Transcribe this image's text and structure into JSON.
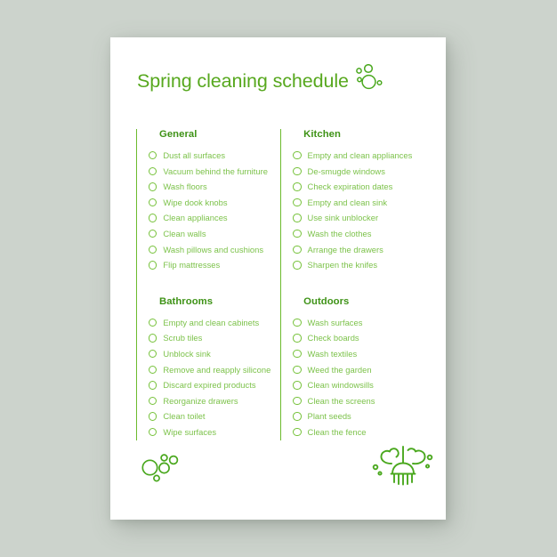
{
  "document": {
    "title": "Spring cleaning schedule",
    "background_color": "#ccd3cc",
    "paper_color": "#ffffff",
    "accent_green": "#57a81e",
    "heading_green": "#3f9317",
    "item_green": "#7cc24a",
    "rule_green": "#6cbb2e"
  },
  "decor": {
    "title_bubbles": "bubbles-icon",
    "footer_left": "bubbles-icon",
    "footer_right": "mop-with-bubbles-icon"
  },
  "columns": [
    {
      "id": "left",
      "sections": [
        {
          "heading": "General",
          "items": [
            "Dust all surfaces",
            "Vacuum behind the furniture",
            "Wash floors",
            "Wipe dook knobs",
            "Clean appliances",
            "Clean walls",
            "Wash pillows and cushions",
            "Flip mattresses"
          ]
        },
        {
          "heading": "Bathrooms",
          "items": [
            "Empty and clean cabinets",
            "Scrub tiles",
            "Unblock sink",
            "Remove and reapply silicone",
            "Discard expired products",
            "Reorganize drawers",
            "Clean toilet",
            "Wipe surfaces"
          ]
        }
      ]
    },
    {
      "id": "right",
      "sections": [
        {
          "heading": "Kitchen",
          "items": [
            "Empty and clean appliances",
            "De-smugde windows",
            "Check expiration dates",
            "Empty and clean sink",
            "Use sink unblocker",
            "Wash the clothes",
            "Arrange the drawers",
            "Sharpen the knifes"
          ]
        },
        {
          "heading": "Outdoors",
          "items": [
            "Wash surfaces",
            "Check boards",
            "Wash textiles",
            "Weed the garden",
            "Clean windowsills",
            "Clean the screens",
            "Plant seeds",
            "Clean the fence"
          ]
        }
      ]
    }
  ]
}
